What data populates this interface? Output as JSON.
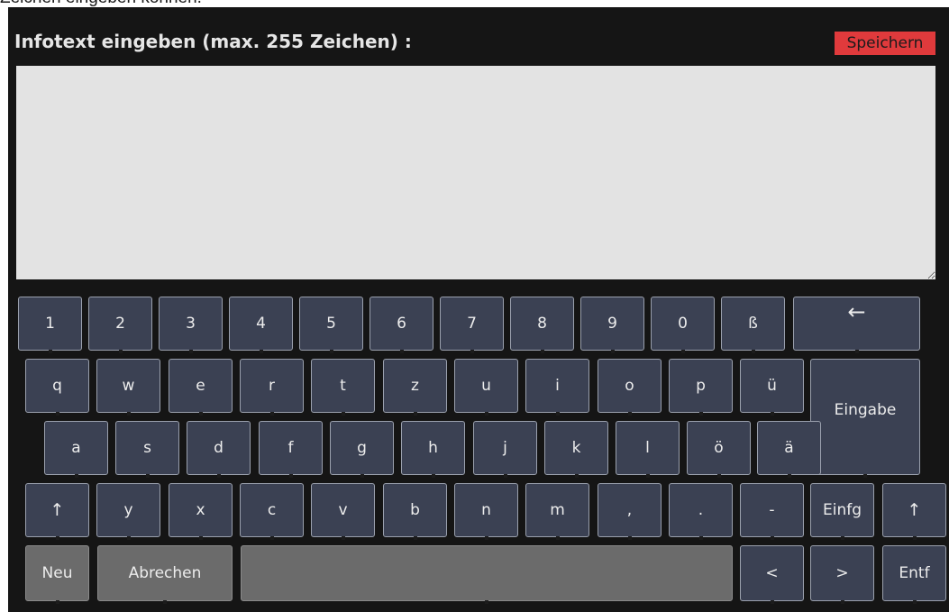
{
  "caption_text": "Zeichen eingeben können.",
  "header": {
    "title": "Infotext eingeben (max. 255 Zeichen) :",
    "save_label": "Speichern"
  },
  "text_input": {
    "value": ""
  },
  "keyboard": {
    "row1": [
      "1",
      "2",
      "3",
      "4",
      "5",
      "6",
      "7",
      "8",
      "9",
      "0",
      "ß"
    ],
    "backspace": "←",
    "row2": [
      "q",
      "w",
      "e",
      "r",
      "t",
      "z",
      "u",
      "i",
      "o",
      "p",
      "ü"
    ],
    "enter": "Eingabe",
    "row3": [
      "a",
      "s",
      "d",
      "f",
      "g",
      "h",
      "j",
      "k",
      "l",
      "ö",
      "ä"
    ],
    "shift_left": "↑",
    "row4": [
      "y",
      "x",
      "c",
      "v",
      "b",
      "n",
      "m",
      ",",
      ".",
      "-"
    ],
    "insert": "Einfg",
    "shift_right": "↑",
    "new": "Neu",
    "cancel": "Abrechen",
    "space": "",
    "left": "<",
    "right": ">",
    "delete": "Entf"
  },
  "colors": {
    "background": "#151515",
    "key": "#3b4153",
    "key_border": "#9aa0ad",
    "save_button": "#e03a3c",
    "text_area": "#e3e3e3",
    "gray_key": "#6b6b6b"
  }
}
